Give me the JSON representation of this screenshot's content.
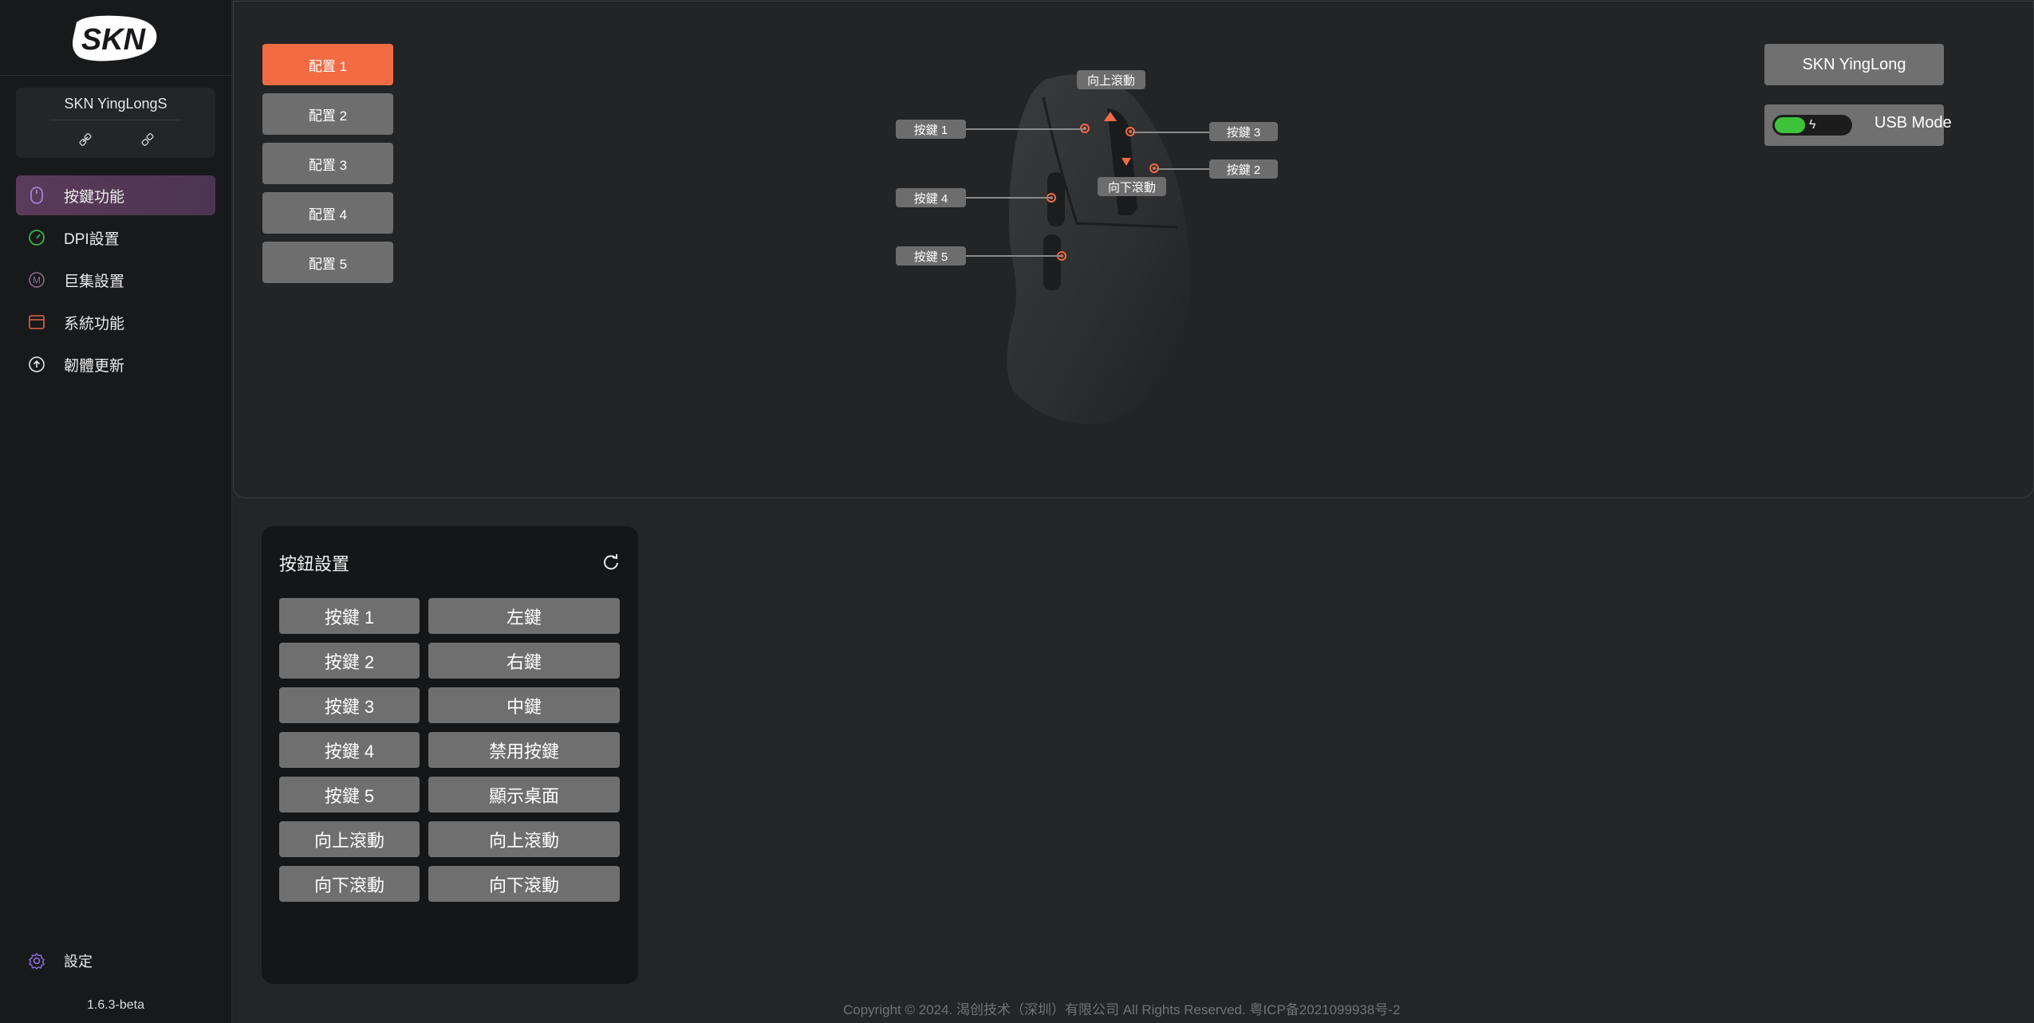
{
  "app": {
    "logo_text": "SKN",
    "device_name": "SKN YingLongS",
    "version": "1.6.3-beta"
  },
  "nav": {
    "items": [
      {
        "label": "按鍵功能",
        "icon": "mouse-icon",
        "active": true
      },
      {
        "label": "DPI設置",
        "icon": "speedometer-icon",
        "active": false
      },
      {
        "label": "巨集設置",
        "icon": "macro-m-icon",
        "active": false
      },
      {
        "label": "系統功能",
        "icon": "window-icon",
        "active": false
      },
      {
        "label": "韌體更新",
        "icon": "upload-circle-icon",
        "active": false
      }
    ],
    "settings_label": "設定"
  },
  "profiles": [
    "配置 1",
    "配置 2",
    "配置 3",
    "配置 4",
    "配置 5"
  ],
  "profile_active_index": 0,
  "header": {
    "device_button": "SKN YingLong",
    "mode_label": "USB Mode",
    "mode_toggle_on": true
  },
  "callouts": {
    "scroll_up": "向上滾動",
    "scroll_down": "向下滾動",
    "key1": "按鍵 1",
    "key2": "按鍵 2",
    "key3": "按鍵 3",
    "key4": "按鍵 4",
    "key5": "按鍵 5"
  },
  "settings": {
    "title": "按鈕設置",
    "rows": [
      {
        "key": "按鍵 1",
        "function": "左鍵"
      },
      {
        "key": "按鍵 2",
        "function": "右鍵"
      },
      {
        "key": "按鍵 3",
        "function": "中鍵"
      },
      {
        "key": "按鍵 4",
        "function": "禁用按鍵"
      },
      {
        "key": "按鍵 5",
        "function": "顯示桌面"
      },
      {
        "key": "向上滾動",
        "function": "向上滾動"
      },
      {
        "key": "向下滾動",
        "function": "向下滾動"
      }
    ]
  },
  "footer": {
    "copyright": "Copyright © 2024. 渴创技术（深圳）有限公司 All Rights Reserved. 粤ICP备2021099938号-2"
  },
  "colors": {
    "accent": "#f26b43",
    "toggle_on": "#3ec23a",
    "nav_active": "#5a3b5a"
  }
}
